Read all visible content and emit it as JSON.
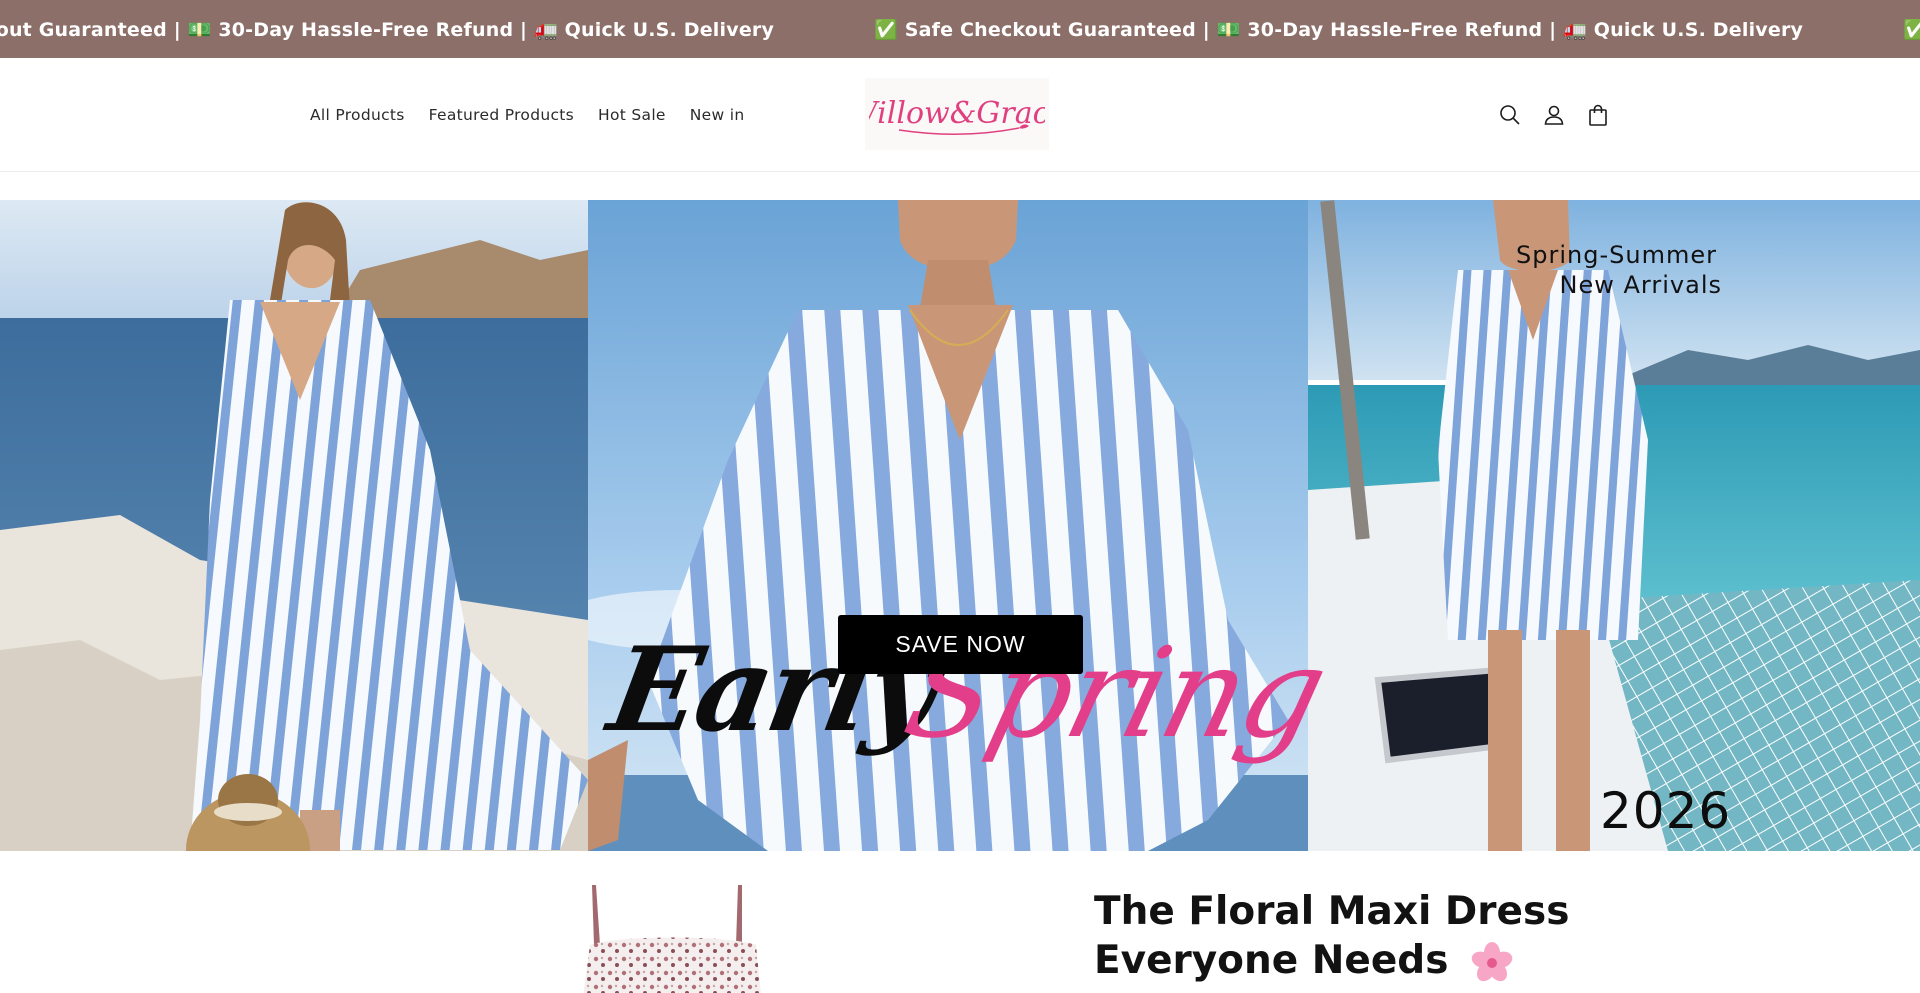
{
  "announcement": {
    "items": [
      "✅ Safe Checkout Guaranteed | 💵 30-Day Hassle-Free Refund | 🚛 Quick U.S. Delivery",
      "✅ Safe Checkout Guaranteed | 💵 30-Day Hassle-Free Refund | 🚛 Quick U.S. Delivery",
      "✅ Safe Checkout Guaranteed | 💵 30-Day Hassle-Free Refund | 🚛 Quick U.S. Delivery"
    ]
  },
  "header": {
    "nav": [
      "All Products",
      "Featured Products",
      "Hot Sale",
      "New in"
    ],
    "logo_text": "Willow&Grace",
    "icons": [
      "search-icon",
      "account-icon",
      "cart-icon"
    ]
  },
  "hero": {
    "headline_left": "Early",
    "headline_right": "Spring",
    "cta_label": "SAVE NOW",
    "season_line1": "Spring-Summer",
    "season_line2": "New Arrivals",
    "year": "2026"
  },
  "promo": {
    "title_line1": "The Floral Maxi Dress",
    "title_line2": "Everyone Needs",
    "emoji": "🌸"
  },
  "colors": {
    "announcement_bg": "#8d6f69",
    "brand_pink": "#e23e8a",
    "cta_bg": "#000000"
  }
}
